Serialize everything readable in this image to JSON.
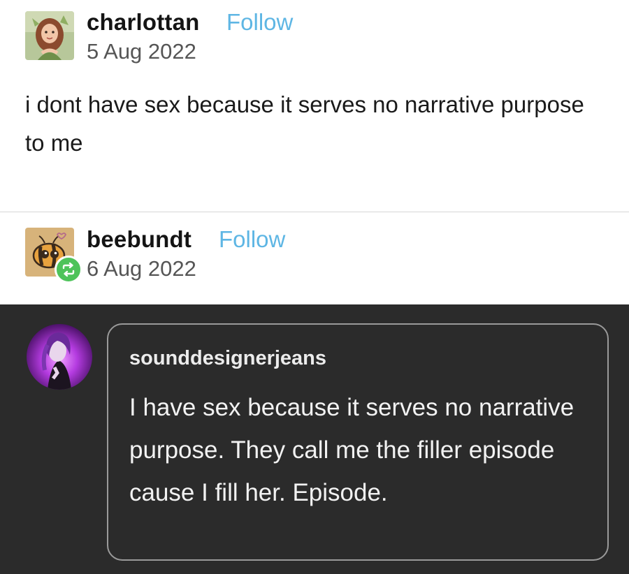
{
  "post1": {
    "username": "charlottan",
    "follow_label": "Follow",
    "date": "5 Aug 2022",
    "text": "i dont have sex because it serves no narrative purpose to me",
    "avatar_icon": "charlottan-avatar-illustration"
  },
  "post2": {
    "username": "beebundt",
    "follow_label": "Follow",
    "date": "6 Aug 2022",
    "avatar_icon": "bee-avatar-illustration",
    "reblog_icon": "reblog-icon"
  },
  "reply": {
    "username": "sounddesignerjeans",
    "text": "I have sex because it serves no narrative purpose. They call me the filler episode cause I fill her. Episode.",
    "avatar_icon": "purple-character-avatar"
  },
  "colors": {
    "follow_blue": "#5eb6e4",
    "reblog_green": "#4ec35a",
    "dark_background": "#2b2b2b",
    "bubble_border": "#9a9a9a"
  }
}
